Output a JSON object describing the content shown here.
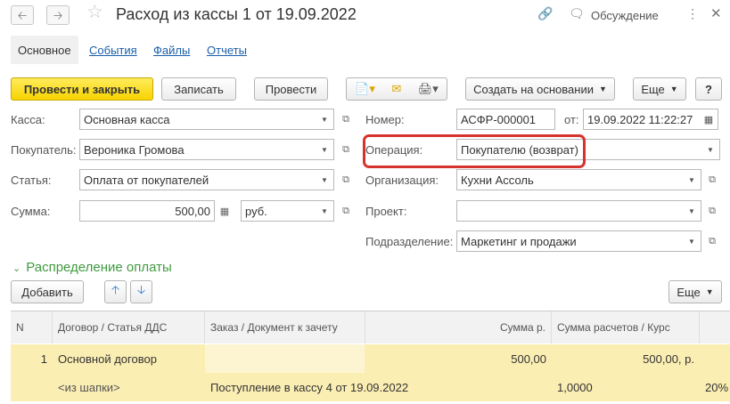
{
  "window": {
    "title": "Расход из кассы 1 от 19.09.2022",
    "discussion_label": "Обсуждение",
    "icons": {
      "back": "arrow-left-icon",
      "forward": "arrow-right-icon",
      "favorite": "star-icon",
      "link": "link-icon",
      "discussion": "chat-icon",
      "more": "vertical-dots-icon",
      "close": "close-icon"
    }
  },
  "tabs": [
    {
      "label": "Основное",
      "active": true
    },
    {
      "label": "События",
      "active": false
    },
    {
      "label": "Файлы",
      "active": false
    },
    {
      "label": "Отчеты",
      "active": false
    }
  ],
  "toolbar": {
    "post_close_label": "Провести и закрыть",
    "save_label": "Записать",
    "post_label": "Провести",
    "create_based_label": "Создать на основании",
    "more_label": "Еще",
    "help_label": "?"
  },
  "form": {
    "kassa": {
      "label": "Касса:",
      "value": "Основная касса"
    },
    "buyer": {
      "label": "Покупатель:",
      "value": "Вероника Громова"
    },
    "article": {
      "label": "Статья:",
      "value": "Оплата от покупателей"
    },
    "amount": {
      "label": "Сумма:",
      "value": "500,00",
      "currency": "руб."
    },
    "number": {
      "label": "Номер:",
      "value": "АСФР-000001",
      "date_label": "от:",
      "date_value": "19.09.2022 11:22:27"
    },
    "operation": {
      "label": "Операция:",
      "value": "Покупателю (возврат)"
    },
    "organization": {
      "label": "Организация:",
      "value": "Кухни Ассоль"
    },
    "project": {
      "label": "Проект:",
      "value": ""
    },
    "department": {
      "label": "Подразделение:",
      "value": "Маркетинг и продажи"
    }
  },
  "distribution": {
    "section_title": "Распределение оплаты",
    "add_label": "Добавить",
    "more_label": "Еще",
    "columns": [
      "N",
      "Договор / Статья ДДС",
      "Заказ / Документ к зачету",
      "Сумма р.",
      "Сумма расчетов / Курс"
    ],
    "rows": [
      {
        "n": "1",
        "contract": "Основной договор",
        "article": "<из шапки>",
        "order": "",
        "document": "Поступление в кассу 4 от 19.09.2022",
        "amount": "500,00",
        "settlement_amount": "500,00, р.",
        "rate": "1,0000",
        "extra": "20%"
      }
    ]
  }
}
